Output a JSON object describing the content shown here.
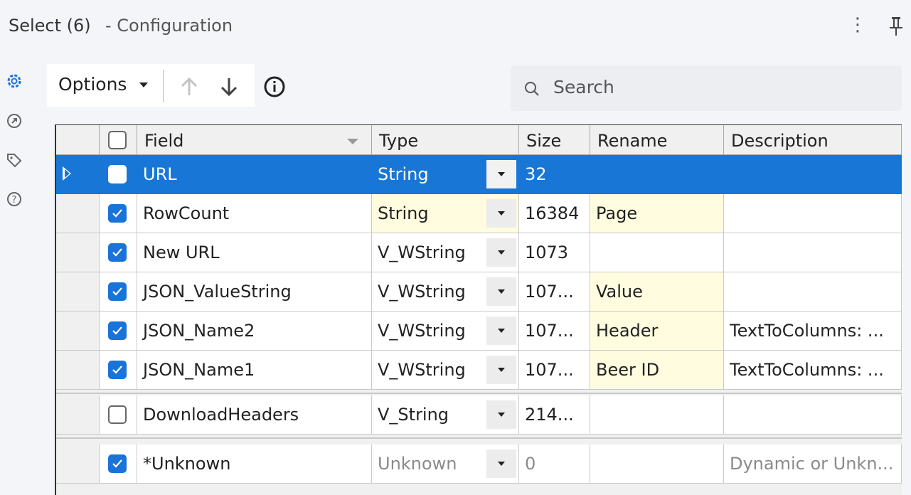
{
  "window": {
    "title": "Select (6)",
    "subtitle": "- Configuration"
  },
  "toolbar": {
    "options_label": "Options",
    "search_placeholder": "Search"
  },
  "left_rail": [
    "gear-icon",
    "arrow-circle-icon",
    "tag-icon",
    "help-icon"
  ],
  "grid": {
    "columns": [
      "Field",
      "Type",
      "Size",
      "Rename",
      "Description"
    ],
    "rows": [
      {
        "checked": false,
        "field": "URL",
        "type": "String",
        "size": "32",
        "rename": "",
        "description": "",
        "selected": true
      },
      {
        "checked": true,
        "field": "RowCount",
        "type": "String",
        "size": "16384",
        "rename": "Page",
        "description": ""
      },
      {
        "checked": true,
        "field": "New URL",
        "type": "V_WString",
        "size": "1073",
        "rename": "",
        "description": ""
      },
      {
        "checked": true,
        "field": "JSON_ValueString",
        "type": "V_WString",
        "size": "107...",
        "rename": "Value",
        "description": ""
      },
      {
        "checked": true,
        "field": "JSON_Name2",
        "type": "V_WString",
        "size": "107...",
        "rename": "Header",
        "description": "TextToColumns: ..."
      },
      {
        "checked": true,
        "field": "JSON_Name1",
        "type": "V_WString",
        "size": "107...",
        "rename": "Beer ID",
        "description": "TextToColumns: ..."
      },
      {
        "checked": false,
        "field": "DownloadHeaders",
        "type": "V_String",
        "size": "214...",
        "rename": "",
        "description": ""
      },
      {
        "checked": true,
        "field": "*Unknown",
        "type": "Unknown",
        "size": "0",
        "rename": "",
        "description": "Dynamic or Unkn..."
      }
    ]
  },
  "colors": {
    "selection": "#1877d6",
    "checkbox_on": "#1a73d9",
    "rename_highlight": "#fffce0",
    "panel_bg": "#f4f5f8"
  }
}
